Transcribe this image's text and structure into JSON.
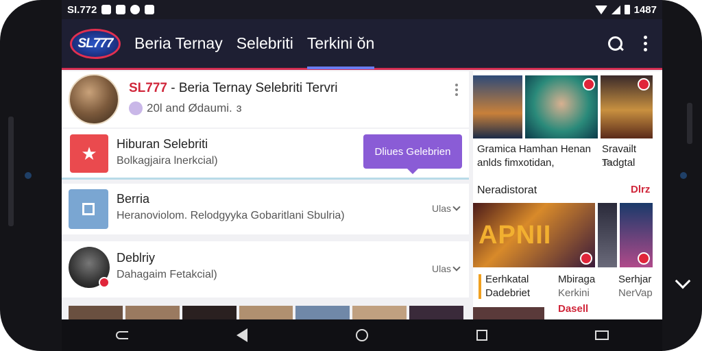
{
  "status_bar": {
    "carrier": "SI.772",
    "time": "1487"
  },
  "app_bar": {
    "logo_text": "SL777",
    "tabs": [
      {
        "label": "Beria Ternay",
        "active": false
      },
      {
        "label": "Selebriti",
        "active": false
      },
      {
        "label": "Terkini ŏn",
        "active": true
      }
    ],
    "search_icon": "search-icon",
    "overflow_icon": "more-vert-icon"
  },
  "post": {
    "title_brand": "SL777",
    "title_rest": " - Beria Ternay Selebriti Tervri",
    "subtitle": "20l and Ødaumi.",
    "subtitle_suffix": "ɜ"
  },
  "rows": [
    {
      "title": "Hiburan Selebriti",
      "subtitle": "Bolkagjaira lnerkcial)",
      "button": "Dliues Gelebrien"
    },
    {
      "title": "Berria",
      "subtitle": "Heranoviolom. Relodgyyka Gobaritlani Sbulria)",
      "right_label": "Ulas"
    },
    {
      "title": "Deblriy",
      "subtitle": "Dahagaim Fetakcial)",
      "right_label": "Ulas"
    }
  ],
  "right_panel": {
    "caption_a": "Gramica Hamhan Henan anlds fimxotidan,",
    "caption_b": "Sravailt\nTadgtal",
    "caption_b_num": "10",
    "section_title": "Neradistorat",
    "section_link": "Dlrz",
    "poster_text": "APNII",
    "bottom_items": [
      {
        "line1": "Eerhkatal",
        "line2": "Dadebriet"
      },
      {
        "line1": "Mbiraga",
        "line2": "Kerkini"
      },
      {
        "line1": "Serhjar",
        "line2": "NerVap"
      }
    ],
    "bottom_link": "Dasell"
  },
  "colors": {
    "accent_red": "#d0263a",
    "accent_purple": "#8a5cd6",
    "appbar_bg": "#1e1f33"
  }
}
